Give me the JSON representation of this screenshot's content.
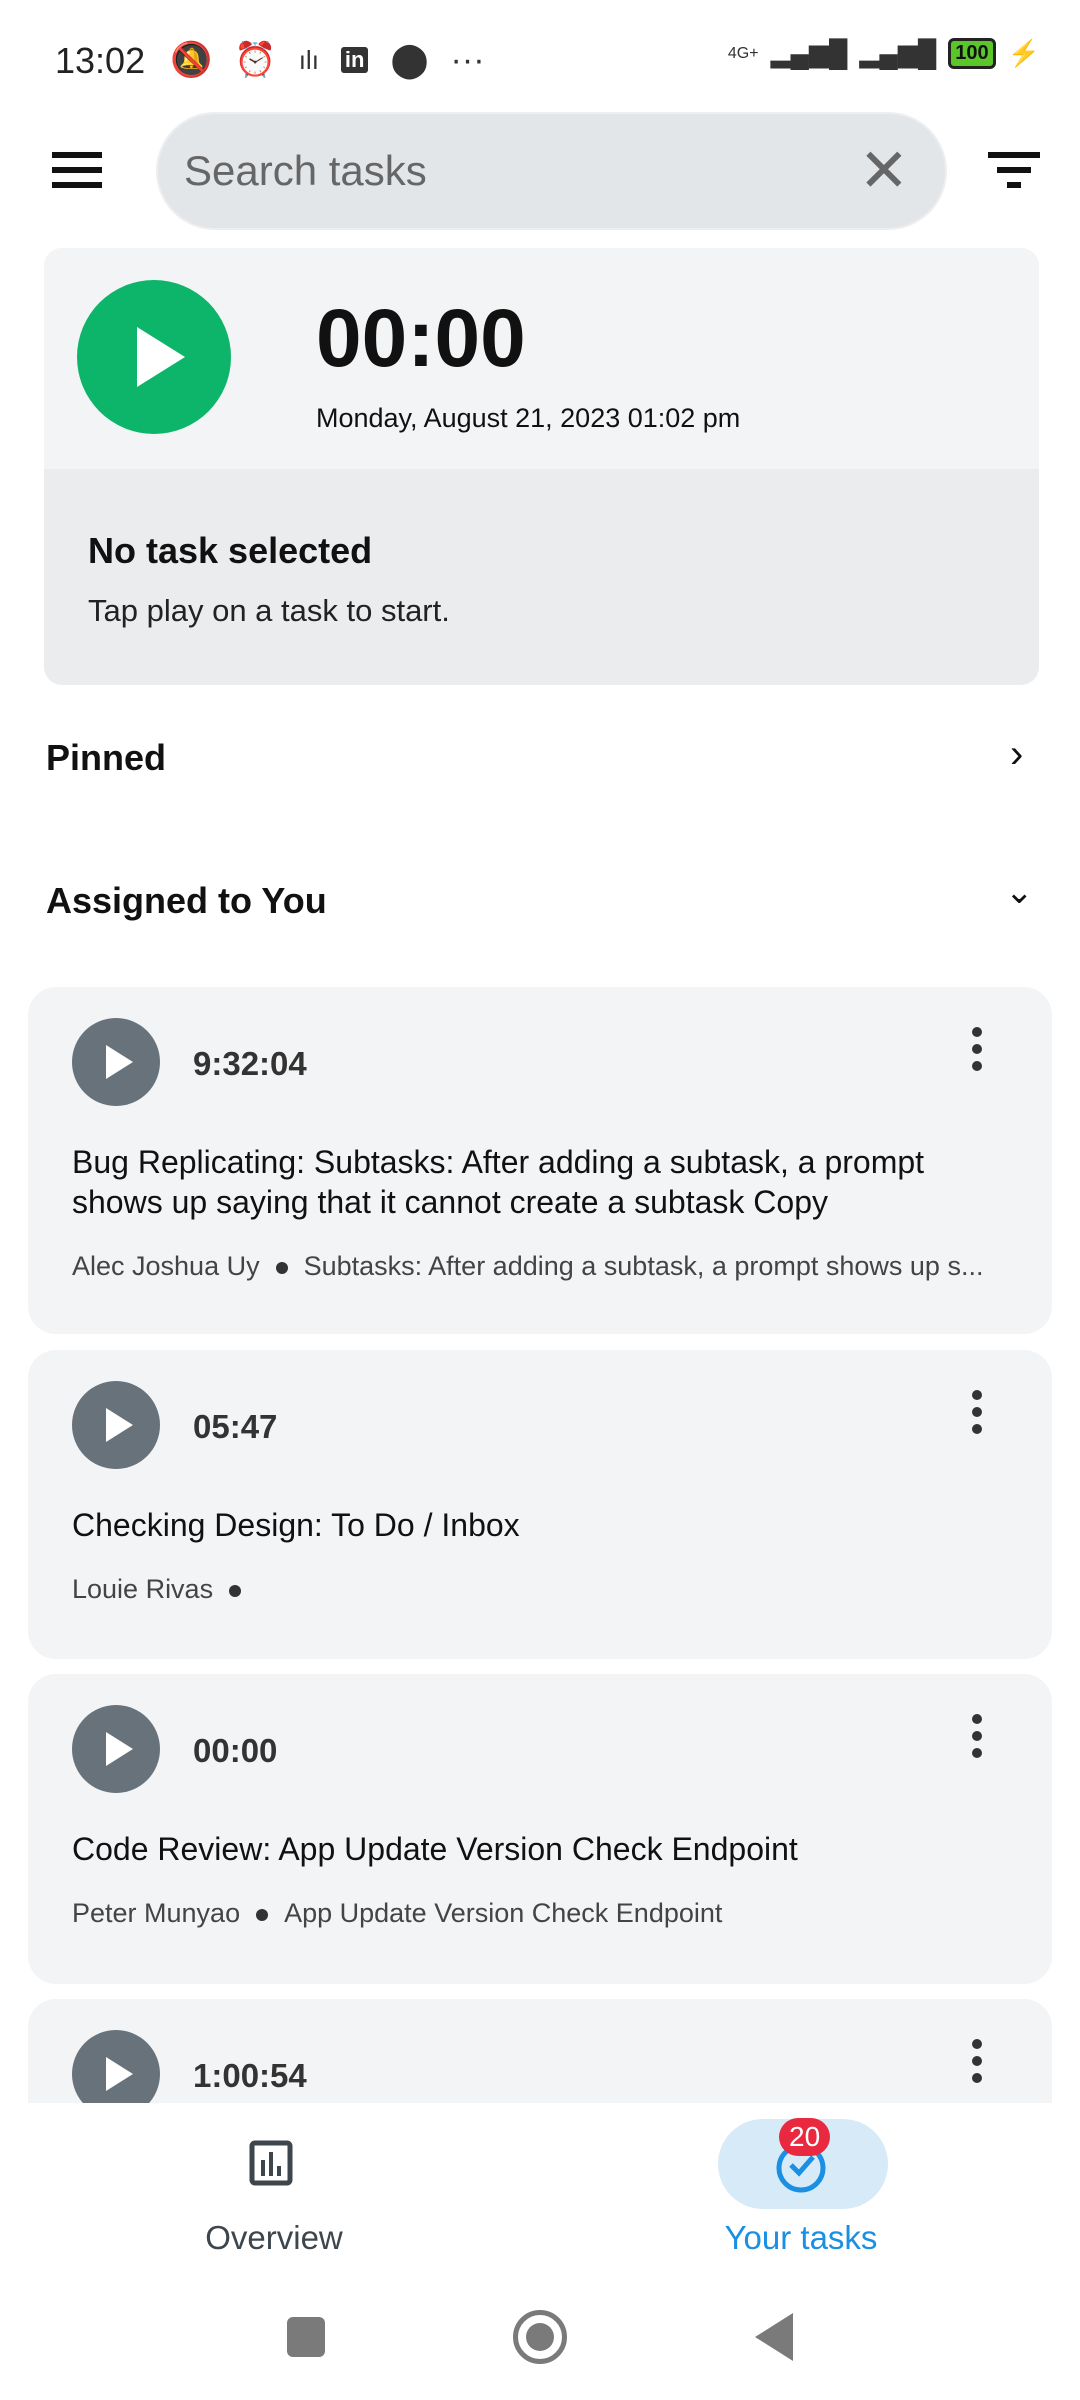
{
  "status_bar": {
    "time": "13:02",
    "icons": [
      "mute-icon",
      "alarm-icon",
      "voice-icon",
      "linkedin-icon",
      "location-icon",
      "more-icon"
    ],
    "network": "4G+",
    "battery": "100"
  },
  "search": {
    "placeholder": "Search tasks",
    "value": ""
  },
  "timer": {
    "elapsed": "00:00",
    "date": "Monday, August 21, 2023 01:02 pm",
    "no_task_title": "No task selected",
    "no_task_hint": "Tap play on a task to start.",
    "accent": "#0db56b"
  },
  "sections": {
    "pinned": "Pinned",
    "assigned": "Assigned to You"
  },
  "tasks": [
    {
      "time": "9:32:04",
      "title": "Bug Replicating: Subtasks: After adding a subtask, a prompt shows up saying that it cannot create a subtask Copy",
      "assignee": "Alec Joshua Uy",
      "parent": "Subtasks: After adding a subtask, a prompt shows up s..."
    },
    {
      "time": "05:47",
      "title": "Checking Design: To Do / Inbox",
      "assignee": "Louie Rivas",
      "parent": ""
    },
    {
      "time": "00:00",
      "title": "Code Review: App Update Version Check Endpoint",
      "assignee": "Peter Munyao",
      "parent": "App Update Version Check Endpoint"
    },
    {
      "time": "1:00:54"
    }
  ],
  "bottom_nav": {
    "overview": "Overview",
    "your_tasks": "Your tasks",
    "badge": "20",
    "active_color": "#1a8fe3"
  }
}
